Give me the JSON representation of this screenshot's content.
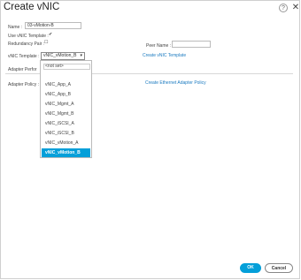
{
  "dialog": {
    "title": "Create vNIC",
    "help_glyph": "?",
    "close_glyph": "✕"
  },
  "form": {
    "name_label": "Name :",
    "name_value": "03-vMotion-B",
    "use_vnic_template_label": "Use vNIC Template :",
    "use_vnic_template_checked": "✔",
    "redundancy_pair_label": "Redundancy Pair :",
    "redundancy_pair_checkbox": "☐",
    "peer_name_label": "Peer Name :",
    "peer_name_value": "",
    "vnic_template_label": "vNIC Template :",
    "vnic_template_selected": "vNIC_vMotion_B",
    "vnic_template_arrow": "▾",
    "create_vnic_template_link": "Create vNIC Template",
    "adapter_tab_label": "Adapter Perfor",
    "adapter_policy_label": "Adapter Policy :",
    "create_eth_adapter_policy_link": "Create Ethernet Adapter Policy"
  },
  "dropdown": {
    "search_placeholder": "",
    "options": [
      {
        "label": "<not set>",
        "state": "normal"
      },
      {
        "label": "",
        "state": "dim"
      },
      {
        "label": "vNIC_App_A",
        "state": "normal"
      },
      {
        "label": "vNIC_App_B",
        "state": "normal"
      },
      {
        "label": "vNIC_Mgmt_A",
        "state": "normal"
      },
      {
        "label": "vNIC_Mgmt_B",
        "state": "normal"
      },
      {
        "label": "vNIC_iSCSI_A",
        "state": "normal"
      },
      {
        "label": "vNIC_iSCSI_B",
        "state": "normal"
      },
      {
        "label": "vNIC_vMotion_A",
        "state": "normal"
      },
      {
        "label": "vNIC_vMotion_B",
        "state": "selected"
      }
    ]
  },
  "footer": {
    "ok_label": "OK",
    "cancel_label": "Cancel"
  },
  "colors": {
    "accent": "#049fd9",
    "link": "#1a7ac0"
  }
}
